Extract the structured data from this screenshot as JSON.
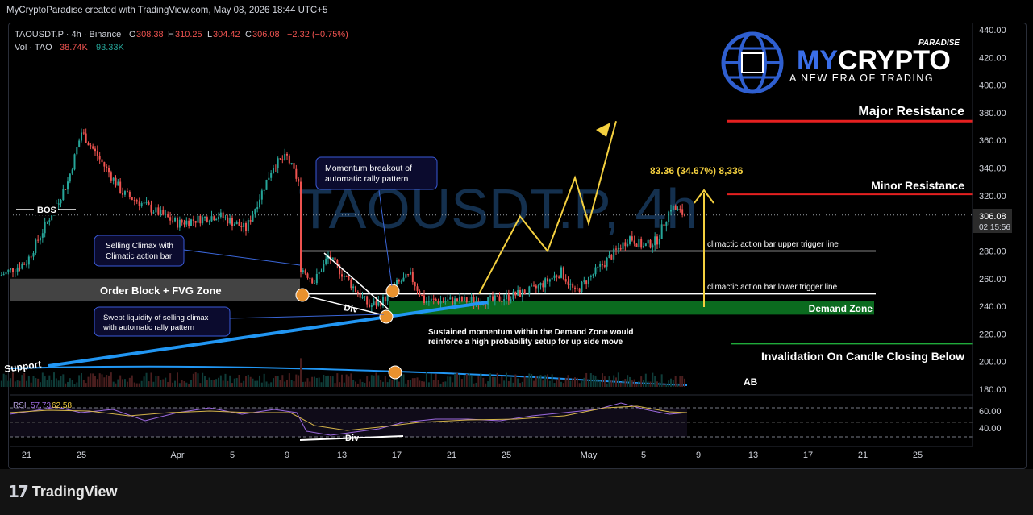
{
  "header": {
    "credit": "MyCryptoParadise created with TradingView.com, May 08, 2026 18:44 UTC+5"
  },
  "legend": {
    "symbol": "TAOUSDT.P · 4h · Binance",
    "o_label": "O",
    "o": "308.38",
    "h_label": "H",
    "h": "310.25",
    "l_label": "L",
    "l": "304.42",
    "c_label": "C",
    "c": "306.08",
    "change": "−2.32 (−0.75%)",
    "vol_label": "Vol · TAO",
    "vol1": "38.74K",
    "vol2": "93.33K"
  },
  "watermark": "TAOUSDT.P, 4h",
  "brand": {
    "top": "PARADISE",
    "name_my": "MY",
    "name_crypto": "CRYPTO",
    "tagline": "A NEW ERA OF TRADING"
  },
  "price_badge": {
    "price": "306.08",
    "countdown": "02:15:56"
  },
  "y_ticks": [
    "440.00",
    "420.00",
    "400.00",
    "380.00",
    "360.00",
    "340.00",
    "320.00",
    "300.00",
    "280.00",
    "260.00",
    "240.00",
    "220.00",
    "200.00",
    "180.00"
  ],
  "rsi_ticks": [
    "60.00",
    "40.00"
  ],
  "x_ticks": [
    "21",
    "25",
    "Apr",
    "5",
    "9",
    "13",
    "17",
    "21",
    "25",
    "May",
    "5",
    "9",
    "13",
    "17",
    "21",
    "25"
  ],
  "rsi": {
    "label": "RSI",
    "v1": "57.73",
    "v2": "62.58"
  },
  "annotations": {
    "bos": "BOS",
    "selling_climax": [
      "Selling Climax with",
      "Climatic action bar"
    ],
    "order_block": "Order Block + FVG Zone",
    "swept": [
      "Swept liquidity of selling climax",
      "with automatic rally pattern"
    ],
    "momentum": [
      "Momentum breakout of",
      "automatic rally pattern"
    ],
    "div": "Div",
    "rsi_div": "Div",
    "support": "Support",
    "sustained": [
      "Sustained momentum within the Demand Zone would",
      "reinforce a high probability setup for up side move"
    ],
    "upper_trigger": "climactic action bar upper trigger line",
    "lower_trigger": "climactic action bar lower trigger line",
    "demand_zone": "Demand Zone",
    "major_resistance": "Major Resistance",
    "minor_resistance": "Minor Resistance",
    "invalidation": "Invalidation On Candle Closing Below",
    "ab": "AB",
    "measure": "83.36 (34.67%) 8,336"
  },
  "colors": {
    "up": "#26a69a",
    "down": "#ef5350",
    "accent": "#f4d03f",
    "support": "#2196f3",
    "demand": "#0b6b1f"
  },
  "footer": {
    "logo": "TradingView"
  },
  "chart_data": {
    "type": "candlestick",
    "symbol": "TAOUSDT.P",
    "interval": "4h",
    "ylim": [
      180,
      440
    ],
    "current_price": 306.08,
    "levels": {
      "major_resistance": 374,
      "minor_resistance": 321,
      "upper_trigger": 280,
      "lower_trigger": 249,
      "demand_zone": [
        234,
        244
      ],
      "invalidation": 213,
      "order_block_zone": [
        244,
        260
      ]
    },
    "path_waypoints": [
      {
        "x": "Mar 19",
        "y": 262
      },
      {
        "x": "Mar 21",
        "y": 272
      },
      {
        "x": "Mar 24",
        "y": 330
      },
      {
        "x": "Mar 25",
        "y": 366
      },
      {
        "x": "Mar 28",
        "y": 322
      },
      {
        "x": "Apr 1",
        "y": 300
      },
      {
        "x": "Apr 4",
        "y": 306
      },
      {
        "x": "Apr 6",
        "y": 296
      },
      {
        "x": "Apr 8",
        "y": 342
      },
      {
        "x": "Apr 9",
        "y": 348
      },
      {
        "x": "Apr 10",
        "y": 326
      },
      {
        "x": "Apr 10",
        "y": 268
      },
      {
        "x": "Apr 11",
        "y": 258
      },
      {
        "x": "Apr 12",
        "y": 276
      },
      {
        "x": "Apr 15",
        "y": 240
      },
      {
        "x": "Apr 16",
        "y": 244
      },
      {
        "x": "Apr 17",
        "y": 256
      },
      {
        "x": "Apr 18",
        "y": 262
      },
      {
        "x": "Apr 19",
        "y": 244
      },
      {
        "x": "Apr 24",
        "y": 244
      },
      {
        "x": "Apr 27",
        "y": 252
      },
      {
        "x": "Apr 29",
        "y": 265
      },
      {
        "x": "Apr 30",
        "y": 250
      },
      {
        "x": "May 2",
        "y": 270
      },
      {
        "x": "May 4",
        "y": 290
      },
      {
        "x": "May 5",
        "y": 283
      },
      {
        "x": "May 6",
        "y": 288
      },
      {
        "x": "May 7",
        "y": 312
      },
      {
        "x": "May 8",
        "y": 306
      }
    ],
    "projection": [
      {
        "x": "Apr 23",
        "y": 249
      },
      {
        "x": "Apr 26",
        "y": 305
      },
      {
        "x": "Apr 28",
        "y": 280
      },
      {
        "x": "Apr 30",
        "y": 333
      },
      {
        "x": "May 1",
        "y": 300
      },
      {
        "x": "May 3",
        "y": 374
      }
    ]
  }
}
